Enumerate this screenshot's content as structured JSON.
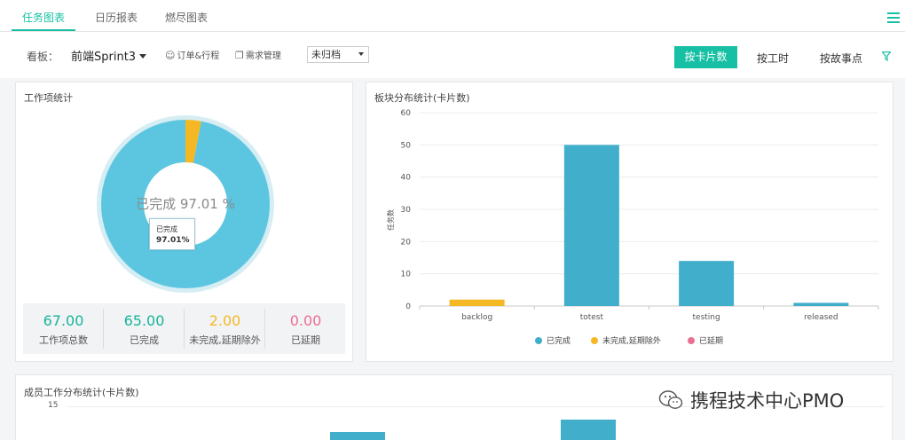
{
  "tabs": [
    {
      "label": "任务图表",
      "active": true
    },
    {
      "label": "日历报表",
      "active": false
    },
    {
      "label": "燃尽图表",
      "active": false
    }
  ],
  "toolbar": {
    "board_label": "看板：",
    "board_value": "前端Sprint3",
    "chip_orders": "订单&行程",
    "chip_requirements": "需求管理",
    "status_value": "未归档",
    "btn_by_card": "按卡片数",
    "btn_by_hours": "按工时",
    "btn_by_points": "按故事点"
  },
  "work_stats": {
    "title": "工作项统计",
    "center_label": "已完成 97.01 %",
    "tooltip_label": "已完成",
    "tooltip_value": "97.01%",
    "completed_fraction": 0.9701,
    "items": [
      {
        "value": "67.00",
        "label": "工作项总数",
        "color": "#17b49a"
      },
      {
        "value": "65.00",
        "label": "已完成",
        "color": "#17b49a"
      },
      {
        "value": "2.00",
        "label": "未完成,延期除外",
        "color": "#f5b825"
      },
      {
        "value": "0.00",
        "label": "已延期",
        "color": "#eb6f94"
      }
    ]
  },
  "block_chart": {
    "title": "板块分布统计(卡片数)",
    "chart_data": {
      "type": "bar",
      "categories": [
        "backlog",
        "totest",
        "testing",
        "released"
      ],
      "series": [
        {
          "name": "已完成",
          "color": "#41afcb",
          "values": [
            0,
            50,
            14,
            1
          ]
        },
        {
          "name": "未完成,延期除外",
          "color": "#f5b825",
          "values": [
            2,
            0,
            0,
            0
          ]
        },
        {
          "name": "已延期",
          "color": "#eb6f94",
          "values": [
            0,
            0,
            0,
            0
          ]
        }
      ],
      "ylabel": "任务数",
      "ylim": [
        0,
        60
      ],
      "yticks": [
        "0",
        "10",
        "20",
        "30",
        "40",
        "50",
        "60"
      ],
      "grid": true,
      "legend": "bottom"
    }
  },
  "member_chart": {
    "title": "成员工作分布统计(卡片数)",
    "ytick_top": "15"
  },
  "watermark": "携程技术中心PMO"
}
